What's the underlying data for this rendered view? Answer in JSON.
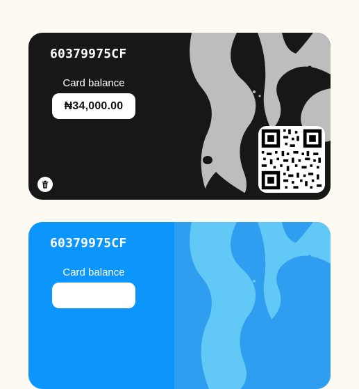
{
  "cards": [
    {
      "card_number": "60379975CF",
      "balance_label": "Card balance",
      "balance_value": "₦34,000.00",
      "theme": "dark",
      "colors": {
        "left": "#171717",
        "pattern_bg": "#171717",
        "pattern_fg": "#BDBDBD"
      },
      "icons": {
        "delete": "trash-icon",
        "qr": "qr-code-icon"
      }
    },
    {
      "card_number": "60379975CF",
      "balance_label": "Card balance",
      "theme": "blue",
      "colors": {
        "left": "#0C95FA",
        "pattern_bg": "#2F9DF0",
        "pattern_fg": "#62C8F5"
      }
    }
  ],
  "page": {
    "background": "#FCFAF3"
  }
}
